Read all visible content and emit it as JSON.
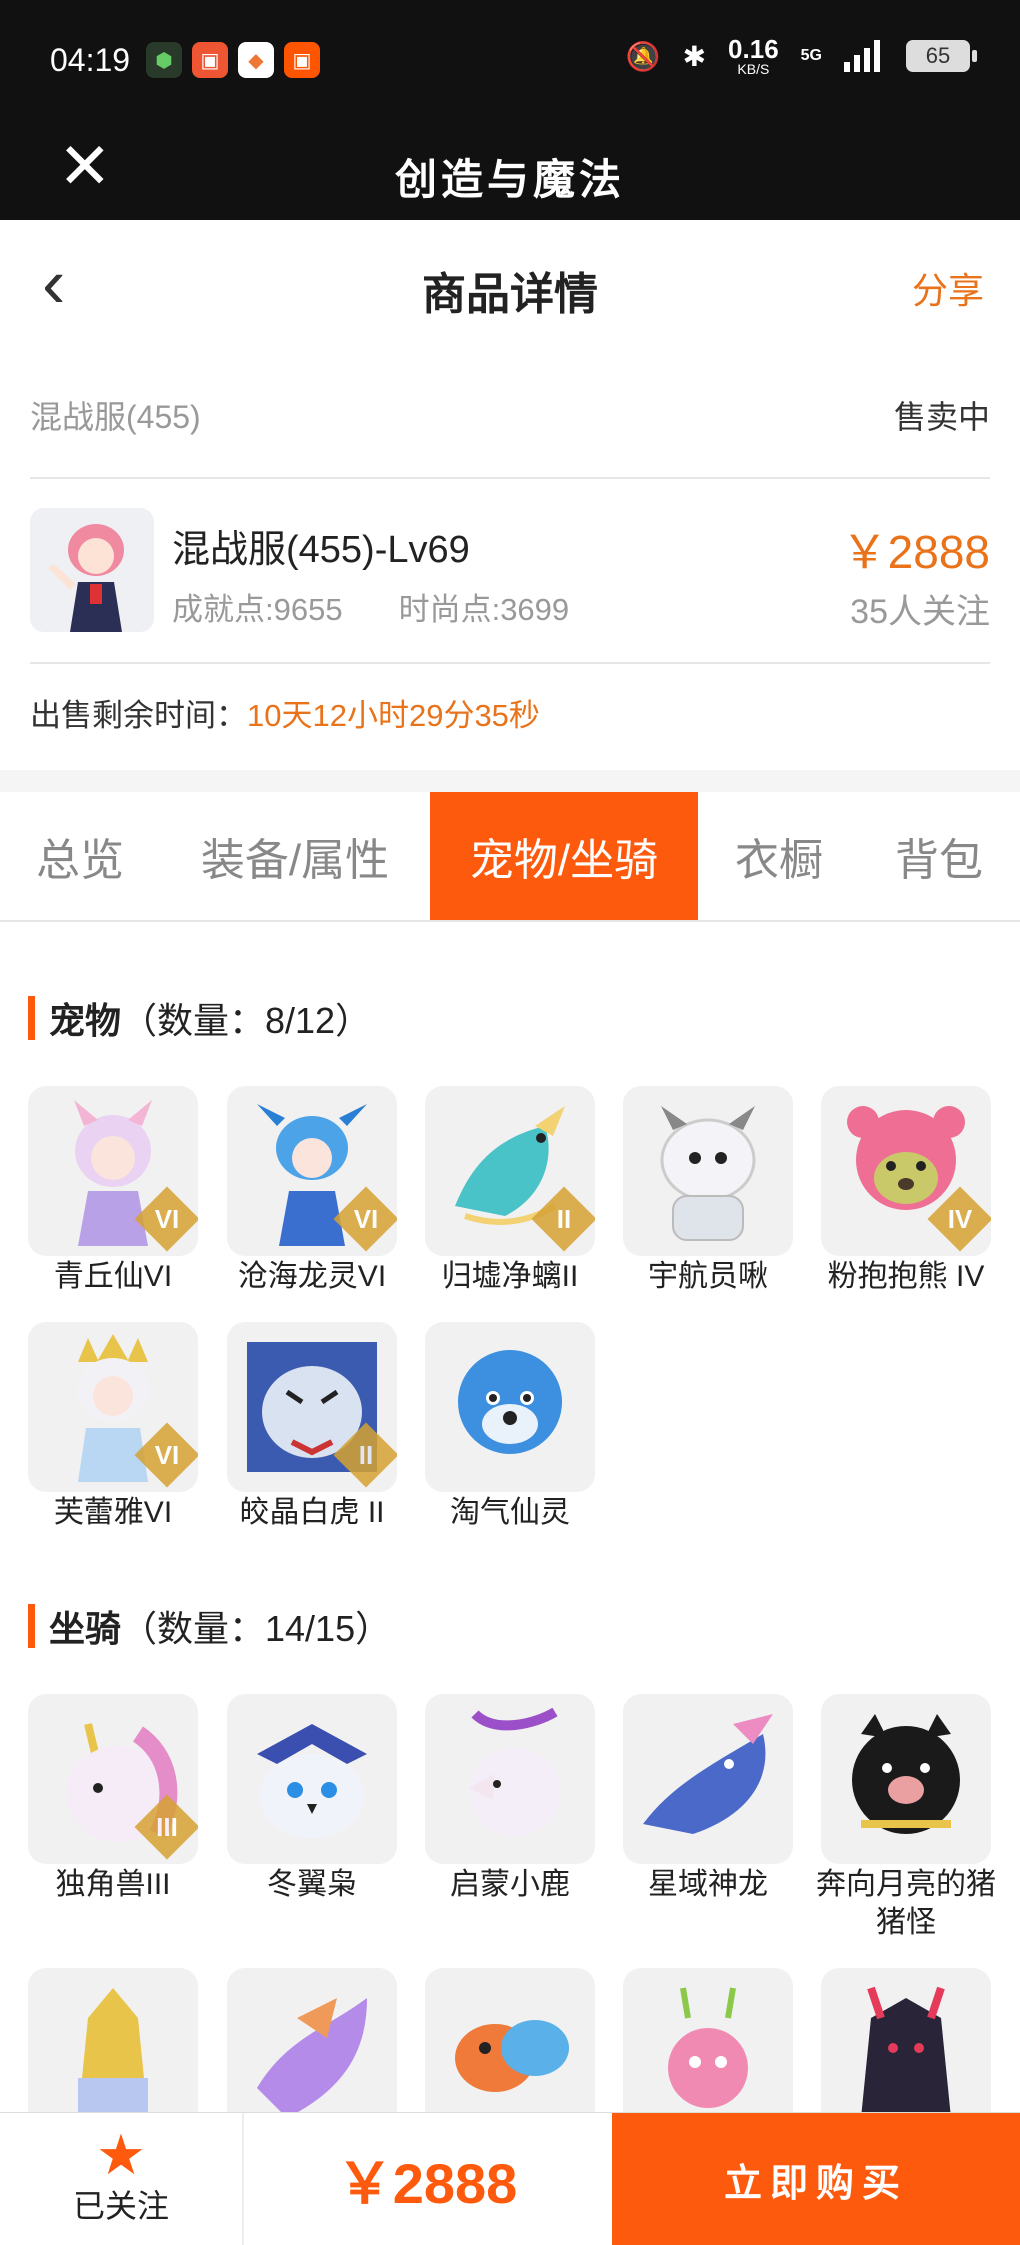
{
  "status_bar": {
    "time": "04:19",
    "net_speed": "0.16",
    "net_unit": "KB/S",
    "network": "5G",
    "battery": "65"
  },
  "titlebar": {
    "title": "创造与魔法",
    "close_icon": "close-icon"
  },
  "navbar": {
    "title": "商品详情",
    "share": "分享"
  },
  "server": {
    "name": "混战服(455)",
    "status": "售卖中"
  },
  "product": {
    "name": "混战服(455)-Lv69",
    "achievement": "成就点:9655",
    "fashion": "时尚点:3699",
    "price": "￥2888",
    "followers": "35人关注"
  },
  "remain": {
    "label": "出售剩余时间：",
    "countdown": "10天12小时29分35秒"
  },
  "tabs": [
    "总览",
    "装备/属性",
    "宠物/坐骑",
    "衣橱",
    "背包"
  ],
  "pets": {
    "title": "宠物",
    "count": "（数量：8/12）",
    "items": [
      {
        "name": "青丘仙VI",
        "badge": "VI"
      },
      {
        "name": "沧海龙灵VI",
        "badge": "VI"
      },
      {
        "name": "归墟净螭II",
        "badge": "II"
      },
      {
        "name": "宇航员啾",
        "badge": ""
      },
      {
        "name": "粉抱抱熊 IV",
        "badge": "IV"
      },
      {
        "name": "芙蕾雅VI",
        "badge": "VI"
      },
      {
        "name": "皎晶白虎 II",
        "badge": "II"
      },
      {
        "name": "淘气仙灵",
        "badge": ""
      }
    ]
  },
  "mounts": {
    "title": "坐骑",
    "count": "（数量：14/15）",
    "items": [
      {
        "name": "独角兽III",
        "badge": "III"
      },
      {
        "name": "冬翼枭",
        "badge": ""
      },
      {
        "name": "启蒙小鹿",
        "badge": ""
      },
      {
        "name": "星域神龙",
        "badge": ""
      },
      {
        "name": "奔向月亮的猪猪怪",
        "badge": ""
      }
    ]
  },
  "bottom": {
    "follow": "已关注",
    "price": "￥2888",
    "buy": "立即购买"
  },
  "colors": {
    "accent": "#fe5a0e",
    "price": "#e9731b"
  }
}
